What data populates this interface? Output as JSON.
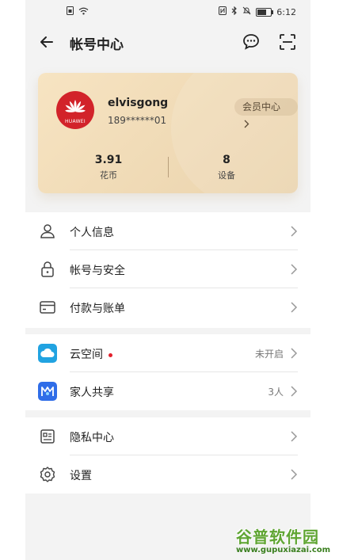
{
  "status_bar": {
    "time": "6:12"
  },
  "header": {
    "title": "帐号中心"
  },
  "account": {
    "brand": "HUAWEI",
    "username": "elvisgong",
    "phone": "189******01",
    "member_center": "会员中心",
    "stats": [
      {
        "value": "3.91",
        "label": "花币"
      },
      {
        "value": "8",
        "label": "设备"
      }
    ]
  },
  "menu_group1": [
    {
      "label": "个人信息",
      "icon": "person-icon"
    },
    {
      "label": "帐号与安全",
      "icon": "lock-icon"
    },
    {
      "label": "付款与账单",
      "icon": "card-icon"
    }
  ],
  "menu_group2": [
    {
      "label": "云空间",
      "icon": "cloud-icon",
      "value": "未开启",
      "badge": true
    },
    {
      "label": "家人共享",
      "icon": "family-share-icon",
      "value": "3人"
    }
  ],
  "menu_group3": [
    {
      "label": "隐私中心",
      "icon": "privacy-icon"
    },
    {
      "label": "设置",
      "icon": "gear-icon"
    }
  ],
  "watermark": {
    "title": "谷普软件园",
    "url": "www.gupuxiazai.com"
  },
  "colors": {
    "brand_red": "#d2232a",
    "card_gold": "#f1dcb8",
    "cloud_blue": "#21a3e1",
    "family_blue": "#2f6de8"
  }
}
